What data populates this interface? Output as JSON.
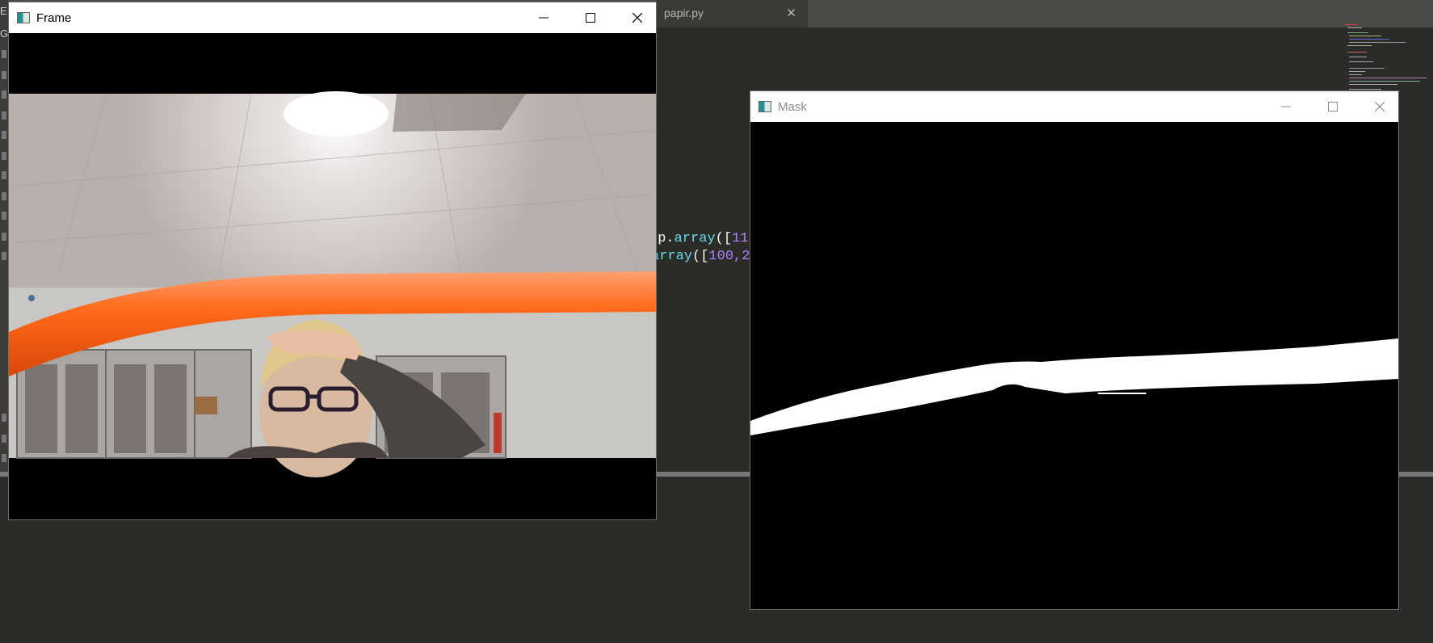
{
  "editor": {
    "tab_name": "papir.py",
    "tab_close": "✕",
    "edge_text_1": "E",
    "edge_text_2": "G",
    "code_line1": {
      "t1": "np.",
      "t2": "array",
      "t3": "([",
      "t4": "11"
    },
    "code_line2": {
      "t1": "array",
      "t2": "([",
      "t3": "100",
      "t4": ",2"
    }
  },
  "windows": {
    "frame": {
      "title": "Frame",
      "icon": "opencv-window-icon",
      "active": true
    },
    "mask": {
      "title": "Mask",
      "icon": "opencv-window-icon",
      "active": false
    }
  },
  "colors": {
    "editor_bg": "#2b2b27",
    "tube_orange": "#ff6a1a",
    "mask_white": "#ffffff"
  }
}
